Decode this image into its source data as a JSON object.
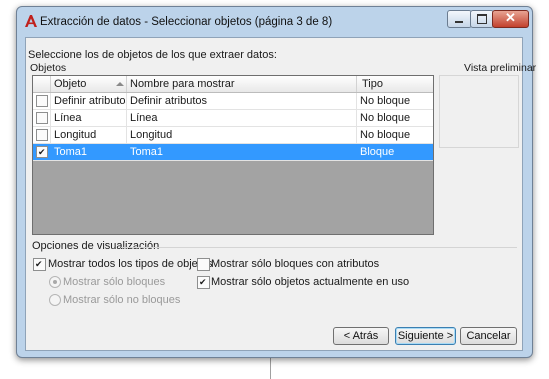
{
  "window": {
    "title": "Extracción de datos - Seleccionar objetos (página 3 de 8)"
  },
  "instruction": "Seleccione los de objetos de los que extraer datos:",
  "objects_group": {
    "label": "Objetos",
    "columns": [
      "Objeto",
      "Nombre para mostrar",
      "Tipo"
    ],
    "rows": [
      {
        "checked": false,
        "objeto": "Definir atributos",
        "nombre": "Definir atributos",
        "tipo": "No bloque"
      },
      {
        "checked": false,
        "objeto": "Línea",
        "nombre": "Línea",
        "tipo": "No bloque"
      },
      {
        "checked": false,
        "objeto": "Longitud",
        "nombre": "Longitud",
        "tipo": "No bloque"
      },
      {
        "checked": true,
        "objeto": "Toma1",
        "nombre": "Toma1",
        "tipo": "Bloque",
        "selected": true
      }
    ]
  },
  "preview": {
    "label": "Vista preliminar"
  },
  "display_options": {
    "label": "Opciones de visualización",
    "show_all_types": {
      "label": "Mostrar todos los tipos de objetos",
      "checked": true
    },
    "only_blocks": {
      "label": "Mostrar sólo bloques"
    },
    "only_non_blocks": {
      "label": "Mostrar sólo no bloques"
    },
    "only_blocks_with_attributes": {
      "label": "Mostrar sólo bloques con atributos",
      "checked": false
    },
    "only_objects_in_use": {
      "label": "Mostrar sólo objetos actualmente en uso",
      "checked": true
    }
  },
  "buttons": {
    "back": "< Atrás",
    "next": "Siguiente >",
    "cancel": "Cancelar"
  },
  "colors": {
    "selection": "#3399ff",
    "grid_background": "#a3a3a3",
    "frame": "#bcd3ea"
  }
}
